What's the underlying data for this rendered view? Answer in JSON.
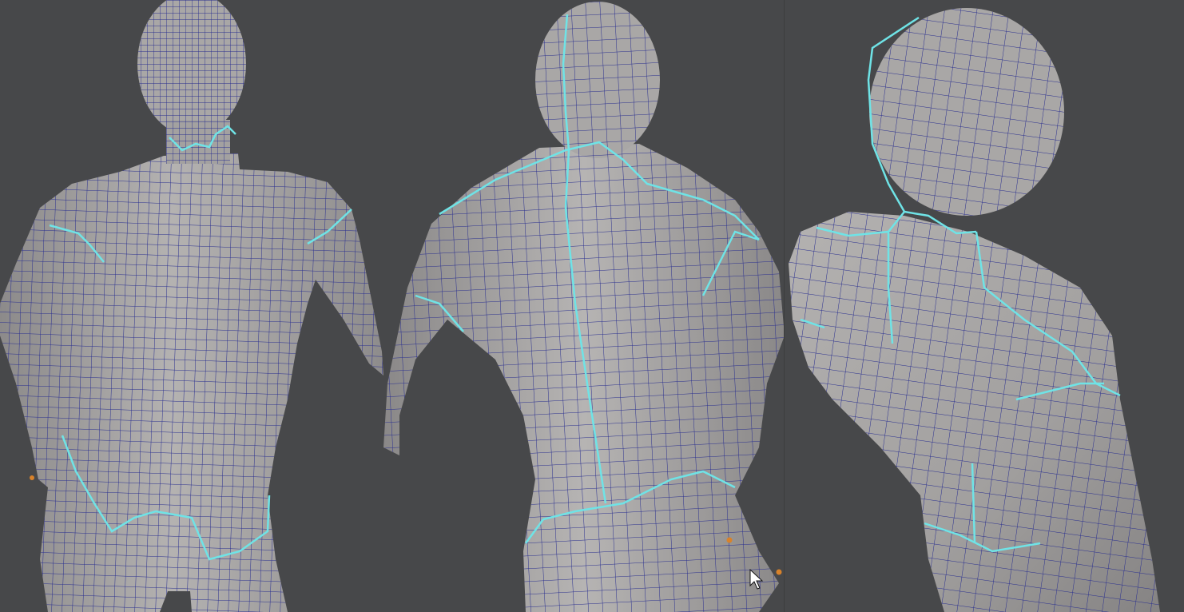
{
  "viewer": {
    "background_color": "#474849",
    "model_color": "#a9a7a6",
    "wireframe_color": "#2a2f8f",
    "seam_color": "#6fe3e6",
    "vertex_marker_color": "#d8822a"
  },
  "viewports": [
    {
      "view": "front",
      "icon": "mesh-front-view-icon"
    },
    {
      "view": "back",
      "icon": "mesh-back-view-icon"
    },
    {
      "view": "back-quarter",
      "icon": "mesh-shoulder-view-icon"
    }
  ],
  "cursor": {
    "icon": "mouse-pointer-icon"
  }
}
